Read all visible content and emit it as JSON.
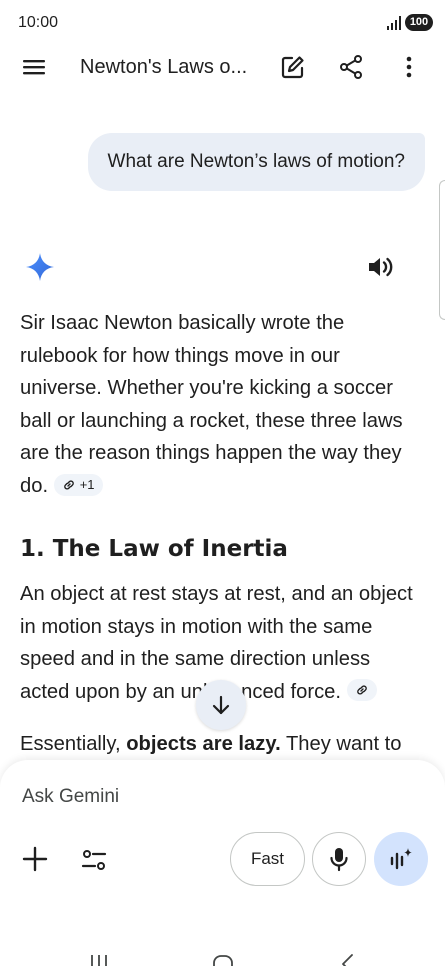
{
  "status_bar": {
    "time": "10:00",
    "battery": "100"
  },
  "app_bar": {
    "title": "Newton's Laws o...",
    "icons": [
      "menu-icon",
      "edit-icon",
      "share-icon",
      "more-vert-icon"
    ]
  },
  "conversation": {
    "user_message": "What are Newton’s laws of motion?",
    "response": {
      "intro": "Sir Isaac Newton basically wrote the rulebook for how things move in our universe. Whether you're kicking a soccer ball or launching a rocket, these three laws are the reason things happen the way they do.",
      "intro_source_chip": "+1",
      "heading": "1. The Law of Inertia",
      "law1_text": "An object at rest stays at rest, and an object in motion stays in motion with the same speed and in the same direction unless acted upon by an unbalanced force.",
      "para3_prefix": "Essentially, ",
      "para3_bold": "objects are lazy.",
      "para3_suffix": " They want to"
    }
  },
  "composer": {
    "placeholder": "Ask Gemini",
    "mode_label": "Fast"
  },
  "colors": {
    "accent": "#4285f4",
    "bubble": "#e9eef6",
    "live_button": "#d3e3fd",
    "text": "#1f1f1f"
  }
}
